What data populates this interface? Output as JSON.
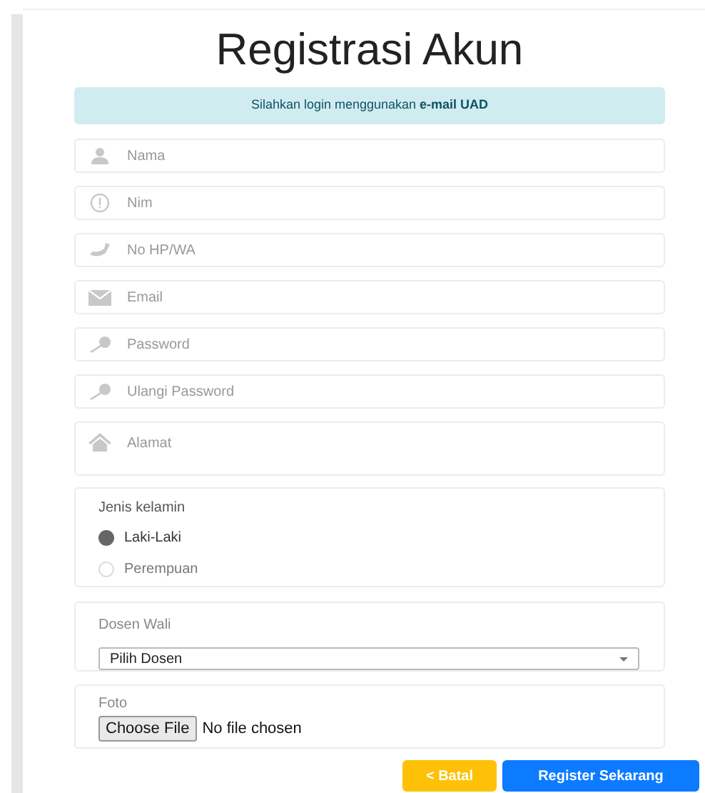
{
  "title": "Registrasi Akun",
  "alert": "Silahkan login menggunakan **e-mail UAD**",
  "fields": [
    {
      "kind": "user",
      "placeholder": "Nama"
    },
    {
      "kind": "info",
      "placeholder": "Nim"
    },
    {
      "kind": "phone",
      "placeholder": "No HP/WA"
    },
    {
      "kind": "mail",
      "placeholder": "Email"
    },
    {
      "kind": "key",
      "placeholder": "Password"
    },
    {
      "kind": "key",
      "placeholder": "Ulangi Password"
    }
  ],
  "address": {
    "kind": "home",
    "placeholder": "Alamat"
  },
  "gender": {
    "label": "Jenis kelamin",
    "options": [
      {
        "label": "Laki-Laki",
        "selected": true
      },
      {
        "label": "Perempuan",
        "selected": false
      }
    ]
  },
  "advisor": {
    "label": "Dosen Wali",
    "value": "Pilih Dosen"
  },
  "photo": {
    "label": "Foto",
    "button": "Choose File",
    "status": "No file chosen"
  },
  "buttons": [
    {
      "kind": "warning",
      "label": "< Batal"
    },
    {
      "kind": "primary",
      "label": "Register Sekarang"
    }
  ]
}
